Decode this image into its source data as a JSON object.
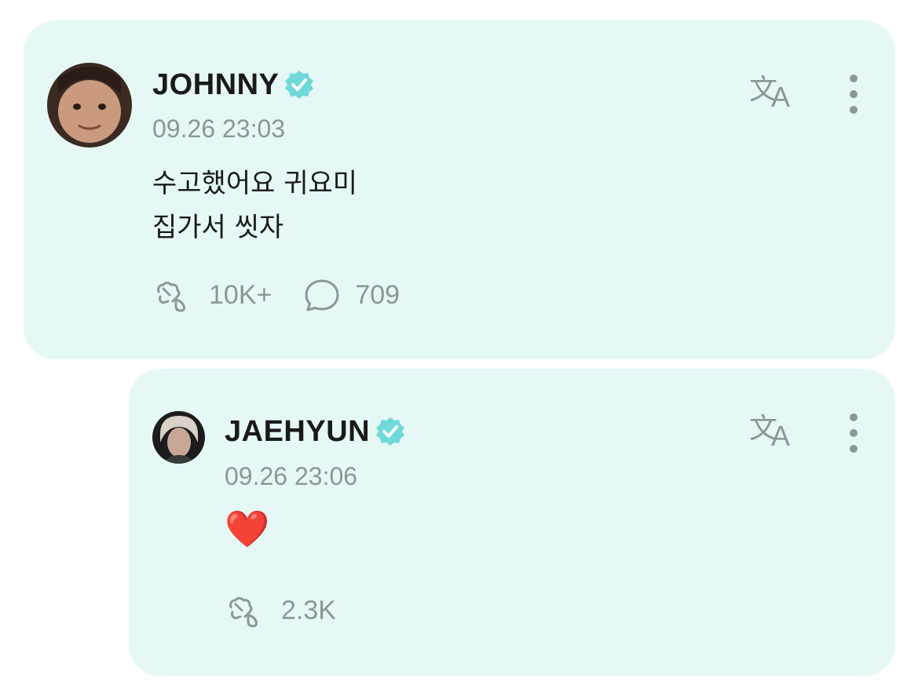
{
  "post": {
    "author": "JOHNNY",
    "timestamp": "09.26 23:03",
    "lines": [
      "수고했어요 귀요미",
      "집가서 씻자"
    ],
    "likes": "10K+",
    "comments": "709",
    "icons": {
      "verified": "verified-badge-icon",
      "translate": "translate-icon",
      "more": "more-vertical-icon",
      "like": "heart-hand-icon",
      "comment": "comment-bubble-icon"
    }
  },
  "reply": {
    "author": "JAEHYUN",
    "timestamp": "09.26 23:06",
    "content": "❤️",
    "likes": "2.3K"
  },
  "colors": {
    "card_bg": "#e6f8f6",
    "accent": "#6fd9d9",
    "muted": "#8d9696",
    "text": "#1a1a1a"
  }
}
